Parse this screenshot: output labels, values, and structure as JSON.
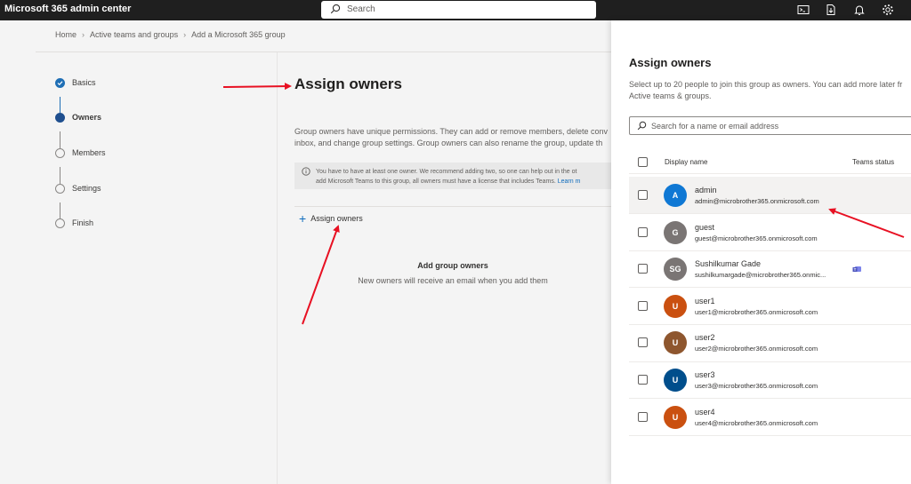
{
  "app": {
    "title": "Microsoft 365 admin center",
    "search_placeholder": "Search",
    "icons": [
      "terminal-icon",
      "download-icon",
      "bell-icon",
      "gear-icon"
    ]
  },
  "breadcrumb": [
    "Home",
    "Active teams and groups",
    "Add a Microsoft 365 group"
  ],
  "wizard": {
    "steps": [
      {
        "label": "Basics",
        "state": "done"
      },
      {
        "label": "Owners",
        "state": "active"
      },
      {
        "label": "Members",
        "state": "pending"
      },
      {
        "label": "Settings",
        "state": "pending"
      },
      {
        "label": "Finish",
        "state": "pending"
      }
    ]
  },
  "content": {
    "title": "Assign owners",
    "desc_line1": "Group owners have unique permissions. They can add or remove members, delete conv",
    "desc_line2": "inbox, and change group settings. Group owners can also rename the group, update th",
    "info_line1": "You have to have at least one owner. We recommend adding two, so one can help out in the ot",
    "info_line2": "add Microsoft Teams to this group, all owners must have a license that includes Teams.",
    "info_link": "Learn m",
    "assign_label": "Assign owners",
    "empty_title": "Add group owners",
    "empty_sub": "New owners will receive an email when you add them"
  },
  "panel": {
    "title": "Assign owners",
    "desc_line1": "Select up to 20 people to join this group as owners. You can add more later fr",
    "desc_line2": "Active teams & groups.",
    "search_placeholder": "Search for a name or email address",
    "col_display_name": "Display name",
    "col_teams_status": "Teams status",
    "users": [
      {
        "initials": "A",
        "name": "admin",
        "email": "admin@microbrother365.onmicrosoft.com",
        "color": "#0f78d4",
        "teams": false,
        "highlight": true
      },
      {
        "initials": "G",
        "name": "guest",
        "email": "guest@microbrother365.onmicrosoft.com",
        "color": "#7a7574",
        "teams": false,
        "highlight": false
      },
      {
        "initials": "SG",
        "name": "Sushilkumar Gade",
        "email": "sushilkumargade@microbrother365.onmic...",
        "color": "#7a7574",
        "teams": true,
        "highlight": false
      },
      {
        "initials": "U",
        "name": "user1",
        "email": "user1@microbrother365.onmicrosoft.com",
        "color": "#ca5010",
        "teams": false,
        "highlight": false
      },
      {
        "initials": "U",
        "name": "user2",
        "email": "user2@microbrother365.onmicrosoft.com",
        "color": "#8e562e",
        "teams": false,
        "highlight": false
      },
      {
        "initials": "U",
        "name": "user3",
        "email": "user3@microbrother365.onmicrosoft.com",
        "color": "#004e8c",
        "teams": false,
        "highlight": false
      },
      {
        "initials": "U",
        "name": "user4",
        "email": "user4@microbrother365.onmicrosoft.com",
        "color": "#ca5010",
        "teams": false,
        "highlight": false
      }
    ]
  },
  "colors": {
    "accent": "#0f6cbd",
    "annotation_arrow": "#e81123"
  }
}
